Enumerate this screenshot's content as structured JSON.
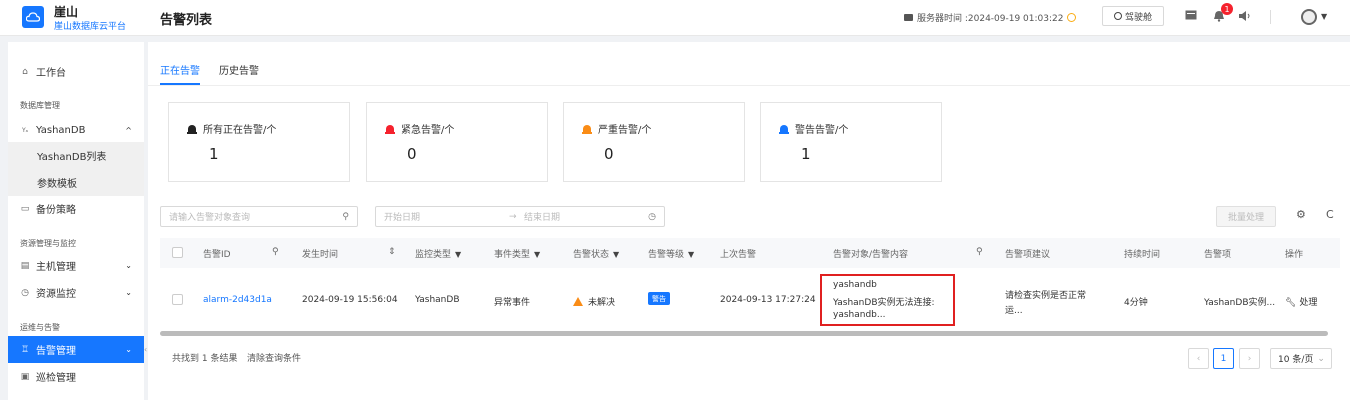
{
  "brand": {
    "name": "崖山",
    "subtitle": "崖山数据库云平台"
  },
  "header": {
    "page_title": "告警列表",
    "server_time": "服务器时间 :2024-09-19 01:03:22",
    "cockpit": "驾驶舱",
    "notification_count": "1"
  },
  "sidebar": {
    "workbench": "工作台",
    "group_db": "数据库管理",
    "yashandb": "YashanDB",
    "yashandb_list": "YashanDB列表",
    "param_template": "参数模板",
    "backup_policy": "备份策略",
    "group_resource": "资源管理与监控",
    "host_mgmt": "主机管理",
    "resource_monitor": "资源监控",
    "group_ops": "运维与告警",
    "alarm_mgmt": "告警管理",
    "inspection_mgmt": "巡检管理"
  },
  "tabs": [
    "正在告警",
    "历史告警"
  ],
  "cards": [
    {
      "label": "所有正在告警/个",
      "value": "1",
      "color": "#222222"
    },
    {
      "label": "紧急告警/个",
      "value": "0",
      "color": "#f5222d"
    },
    {
      "label": "严重告警/个",
      "value": "0",
      "color": "#fa8c16"
    },
    {
      "label": "警告告警/个",
      "value": "1",
      "color": "#1677ff"
    }
  ],
  "filters": {
    "search_placeholder": "请输入告警对象查询",
    "start_date": "开始日期",
    "arrow": "→",
    "end_date": "结束日期",
    "batch_btn": "批量处理"
  },
  "table": {
    "columns": [
      "告警ID",
      "发生时间",
      "监控类型",
      "事件类型",
      "告警状态",
      "告警等级",
      "上次告警",
      "告警对象/告警内容",
      "告警项建议",
      "持续时间",
      "告警项",
      "操作"
    ],
    "row": {
      "id": "alarm-2d43d1a",
      "time": "2024-09-19 15:56:04",
      "monitor_type": "YashanDB",
      "event_type": "异常事件",
      "status": "未解决",
      "level": "警告",
      "last_alarm": "2024-09-13 17:27:24",
      "content_line1": "yashandb",
      "content_line2": "YashanDB实例无法连接:",
      "content_line3": "yashandb...",
      "suggestion_line1": "请检查实例是否正常",
      "suggestion_line2": "运...",
      "duration": "4分钟",
      "item": "YashanDB实例...",
      "action": "处理"
    }
  },
  "footer": {
    "result": "共找到 1 条结果",
    "clear": "清除查询条件",
    "current_page": "1",
    "page_size": "10 条/页"
  }
}
